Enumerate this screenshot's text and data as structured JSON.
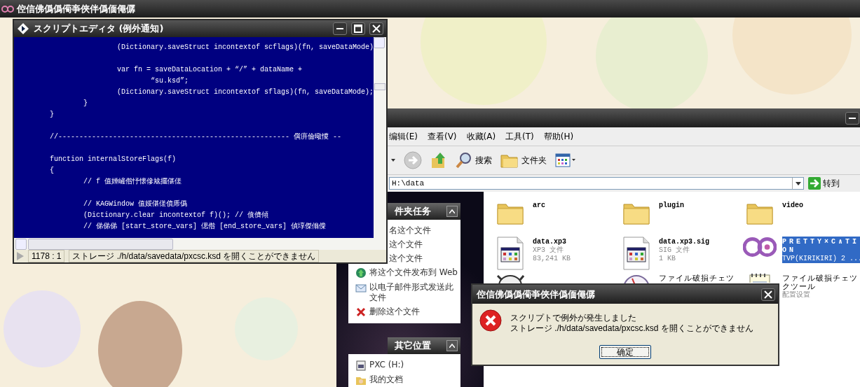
{
  "app_window": {
    "title": "倥信佛僞僞僃亊俠伴僞偭僶僝"
  },
  "script_editor": {
    "title": "スクリプトエディタ (例外通知)",
    "lines": [
      {
        "text": "                (Dictionary.saveStruct incontextof scflags)(fn, saveDataMode)",
        "spacer_before": false
      },
      {
        "text": "                var fn = saveDataLocation + “/” + dataName +",
        "spacer_before": true
      },
      {
        "text": "                        “su.ksd”;",
        "spacer_before": false
      },
      {
        "text": "                (Dictionary.saveStruct incontextof sflags)(fn, saveDataMode);",
        "spacer_before": false
      },
      {
        "text": "        }",
        "spacer_before": false
      },
      {
        "text": "}",
        "spacer_before": false
      },
      {
        "text": "//------------------------------------------------------- 僎庰儉曔惾 --",
        "spacer_before": true
      },
      {
        "text": "function internalStoreFlags(f)",
        "spacer_before": true
      },
      {
        "text": "{",
        "spacer_before": false
      },
      {
        "text": "        // f 值娷嵼偺忬懐傪奿擺偡傞",
        "spacer_before": false
      },
      {
        "text": "        // KAGWindow 值娞偡傞僨乕僞",
        "spacer_before": true
      },
      {
        "text": "        (Dictionary.clear incontextof f)(); // 僋儕傾",
        "spacer_before": false
      },
      {
        "text": "        // 俤俤俤 [start_store_vars] 偲偺 [end_store_vars] 偵埻傑傟偨",
        "spacer_before": false
      }
    ],
    "position": "1178 : 1",
    "message": "ストレージ ./h/data/savedata/pxcsc.ksd を開くことができません"
  },
  "explorer": {
    "menu": [
      "编辑(E)",
      "查看(V)",
      "收藏(A)",
      "工具(T)",
      "帮助(H)"
    ],
    "toolbar": [
      {
        "kind": "caret"
      },
      {
        "kind": "forward"
      },
      {
        "kind": "up"
      },
      {
        "kind": "search",
        "label": "搜索"
      },
      {
        "kind": "folders",
        "label": "文件夹"
      },
      {
        "kind": "views"
      }
    ],
    "address": "H:\\data",
    "go_label": "转到",
    "panels": [
      {
        "title": "件夹任务",
        "expanded": true,
        "items": [
          {
            "kind": "plain",
            "label": "名这个文件"
          },
          {
            "kind": "plain",
            "label": "这个文件"
          },
          {
            "kind": "plain",
            "label": "这个文件"
          },
          {
            "kind": "globe",
            "label": "将这个文件发布到 Web"
          },
          {
            "kind": "mail",
            "label": "以电子邮件形式发送此文件"
          },
          {
            "kind": "delete",
            "label": "删除这个文件"
          }
        ]
      },
      {
        "title": "其它位置",
        "expanded": true,
        "items": [
          {
            "kind": "drive",
            "label": "PXC (H:)"
          },
          {
            "kind": "documents",
            "label": "我的文档"
          }
        ]
      }
    ],
    "files": [
      {
        "kind": "folder",
        "name": "arc",
        "selected": false
      },
      {
        "kind": "folder",
        "name": "plugin",
        "selected": false
      },
      {
        "kind": "folder",
        "name": "video",
        "selected": false
      },
      {
        "kind": "document",
        "name": "data.xp3",
        "type": "XP3 文件",
        "size": "83,241 KB",
        "selected": false
      },
      {
        "kind": "document",
        "name": "data.xp3.sig",
        "type": "SIG 文件",
        "size": "1 KB",
        "selected": false
      },
      {
        "kind": "logo",
        "name": "PRETTY×C∧TION",
        "type": "TVP(KIRIKIRI) 2 ...",
        "selected": true
      },
      {
        "kind": "tool",
        "selected": false
      },
      {
        "kind": "gauge",
        "name": "ファイル破損チェツ",
        "selected": false
      },
      {
        "kind": "notes",
        "name": "ファイル破損チェツクツール",
        "type": "配置设置",
        "selected": false
      }
    ]
  },
  "error_dialog": {
    "title": "倥信佛僞僞僃亊俠伴僞偭僶僝",
    "lines": [
      "スクリプトで例外が発生しました",
      "ストレージ ./h/data/savedata/pxcsc.ksd を開くことができません"
    ],
    "button": "确定"
  }
}
